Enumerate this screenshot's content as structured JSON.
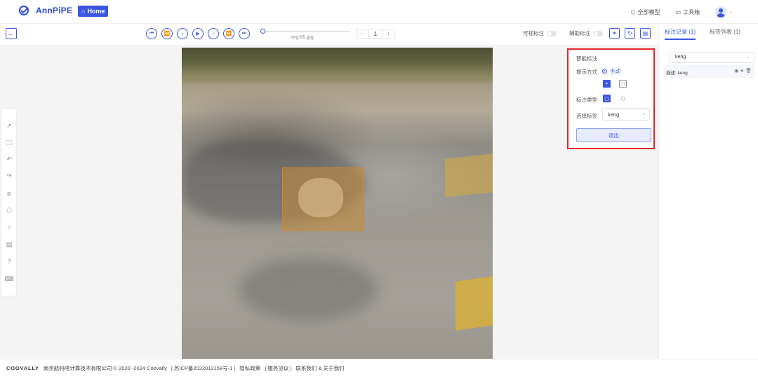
{
  "header": {
    "logo_text": "AnnPiPE",
    "home_label": "Home",
    "all_models": "全部模型",
    "toolbox": "工具箱"
  },
  "toolbar": {
    "filename": "img-85.jpg",
    "page_value": "1",
    "visible_label": "可视标注",
    "assist_label": "辅助标注",
    "progress_fraction": 0
  },
  "smart_panel": {
    "title": "智能标注",
    "prompt_mode_label": "提示方式",
    "prompt_mode_value": "手动",
    "annotation_type_label": "标注类型",
    "select_label_label": "选择标签",
    "select_label_value": "keng",
    "exit_label": "退出"
  },
  "right_panel": {
    "tab_records": "标注记录 (1)",
    "tab_labels": "标签列表 (1)",
    "filter_value": "keng",
    "record_text": "描述: keng"
  },
  "footer": {
    "brand": "COOVALLY",
    "company": "南京航码嗒计算技术有限公司 © 2020 -2024 Coovally",
    "icp": "| 苏ICP备2022012159号-1 |",
    "privacy": "隐私政策",
    "terms": "| 服务协议 |",
    "contact": "联系我们 & 关于我们"
  },
  "colors": {
    "accent": "#3b56e0",
    "highlight_border": "#e5252a",
    "bbox_fill": "#c48c37"
  }
}
